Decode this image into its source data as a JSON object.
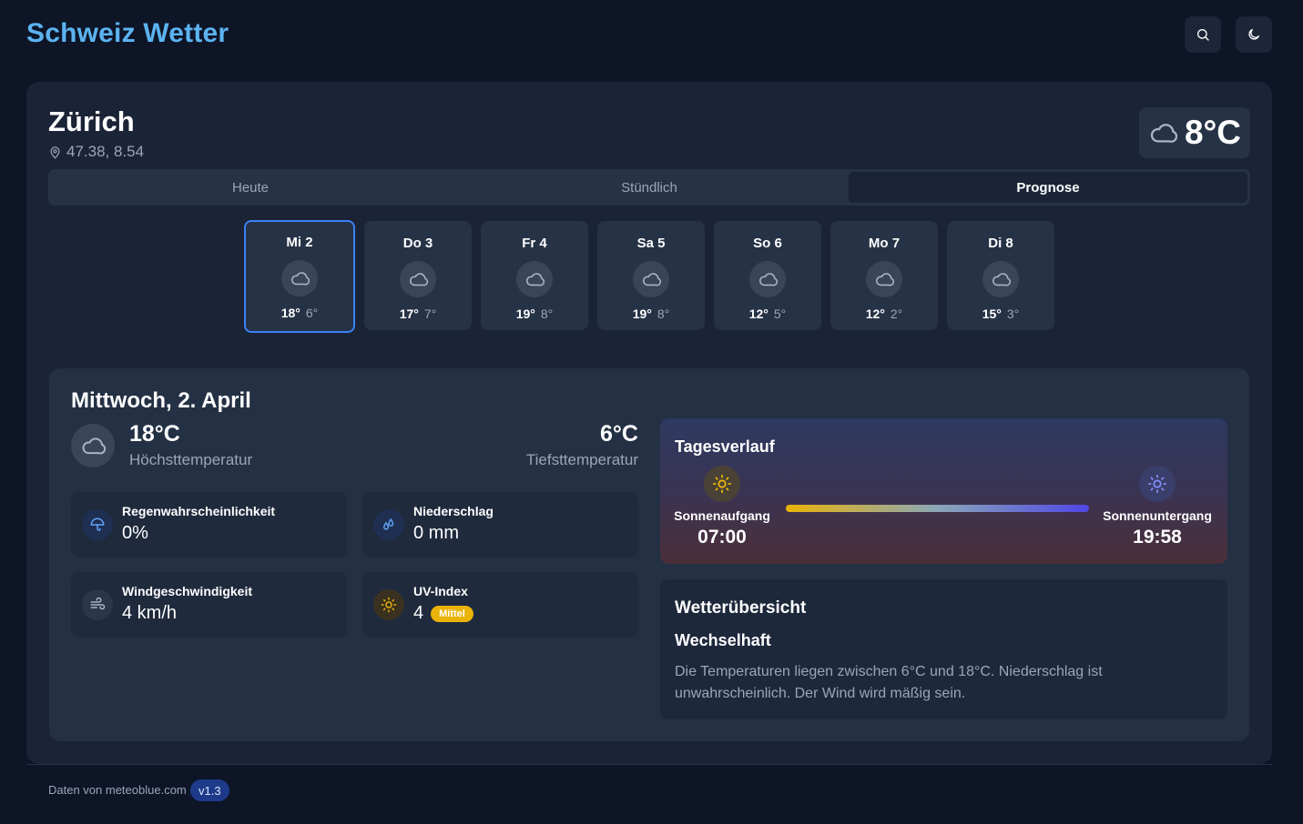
{
  "app": {
    "title": "Schweiz Wetter",
    "search_icon": "search-icon",
    "theme_icon": "moon-icon"
  },
  "location": {
    "city": "Zürich",
    "coords": "47.38, 8.54",
    "current_temp": "8°C",
    "current_icon": "cloud-icon"
  },
  "tabs": [
    {
      "label": "Heute",
      "active": false
    },
    {
      "label": "Stündlich",
      "active": false
    },
    {
      "label": "Prognose",
      "active": true
    }
  ],
  "days": [
    {
      "label": "Mi 2",
      "hi": "18°",
      "lo": "6°",
      "icon": "cloud-icon",
      "selected": true
    },
    {
      "label": "Do 3",
      "hi": "17°",
      "lo": "7°",
      "icon": "cloud-icon",
      "selected": false
    },
    {
      "label": "Fr 4",
      "hi": "19°",
      "lo": "8°",
      "icon": "cloud-icon",
      "selected": false
    },
    {
      "label": "Sa 5",
      "hi": "19°",
      "lo": "8°",
      "icon": "cloud-icon",
      "selected": false
    },
    {
      "label": "So 6",
      "hi": "12°",
      "lo": "5°",
      "icon": "cloud-icon",
      "selected": false
    },
    {
      "label": "Mo 7",
      "hi": "12°",
      "lo": "2°",
      "icon": "cloud-icon",
      "selected": false
    },
    {
      "label": "Di 8",
      "hi": "15°",
      "lo": "3°",
      "icon": "cloud-icon",
      "selected": false
    }
  ],
  "detail": {
    "title": "Mittwoch, 2. April",
    "high": "18°C",
    "high_label": "Höchsttemperatur",
    "low": "6°C",
    "low_label": "Tiefsttemperatur",
    "stats": {
      "rain_chance": {
        "label": "Regenwahrscheinlichkeit",
        "value": "0%",
        "icon": "umbrella-icon"
      },
      "precipitation": {
        "label": "Niederschlag",
        "value": "0 mm",
        "icon": "droplets-icon"
      },
      "wind": {
        "label": "Windgeschwindigkeit",
        "value": "4 km/h",
        "icon": "wind-icon"
      },
      "uv": {
        "label": "UV-Index",
        "value": "4",
        "badge": "Mittel",
        "icon": "sun-icon"
      }
    }
  },
  "day_progress": {
    "title": "Tagesverlauf",
    "sunrise_label": "Sonnenaufgang",
    "sunrise_time": "07:00",
    "sunset_label": "Sonnenuntergang",
    "sunset_time": "19:58"
  },
  "overview": {
    "title": "Wetterübersicht",
    "condition": "Wechselhaft",
    "text": "Die Temperaturen liegen zwischen 6°C und 18°C. Niederschlag ist unwahrscheinlich. Der Wind wird mäßig sein."
  },
  "footer": {
    "source": "Daten von meteoblue.com",
    "version": "v1.3"
  },
  "colors": {
    "accent": "#5cb3f0",
    "selected_border": "#3b82f6",
    "uv_badge": "#eab308",
    "sunrise": "#eab308",
    "sunset": "#6366f1"
  }
}
